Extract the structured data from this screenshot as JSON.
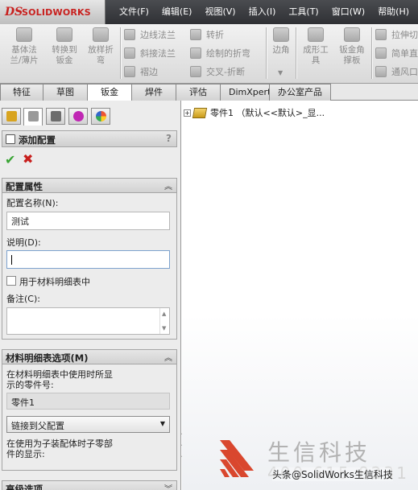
{
  "app": {
    "logo_ds": "DS",
    "logo_name": "SOLIDWORKS"
  },
  "menu": [
    "文件(F)",
    "编辑(E)",
    "视图(V)",
    "插入(I)",
    "工具(T)",
    "窗口(W)",
    "帮助(H)"
  ],
  "ribbon": {
    "large": [
      {
        "line1": "基体法",
        "line2": "兰/薄片"
      },
      {
        "line1": "转换到",
        "line2": "钣金"
      },
      {
        "line1": "放样折",
        "line2": "弯"
      },
      {
        "line1": "边角",
        "line2": ""
      },
      {
        "line1": "成形工",
        "line2": "具"
      },
      {
        "line1": "钣金角",
        "line2": "撑板"
      }
    ],
    "small": [
      "边线法兰",
      "斜接法兰",
      "褶边",
      "转折",
      "绘制的折弯",
      "交叉-折断",
      "拉伸切",
      "简单直",
      "通风口"
    ]
  },
  "tabs": [
    "特征",
    "草图",
    "钣金",
    "焊件",
    "评估",
    "DimXpert",
    "办公室产品"
  ],
  "property_manager": {
    "title": "添加配置",
    "help": "?",
    "ok": "✔",
    "cancel": "✖",
    "config_group": {
      "title": "配置属性",
      "name_label": "配置名称(N):",
      "name_value": "测试",
      "desc_label": "说明(D):",
      "desc_value": "",
      "bom_checkbox_label": "用于材料明细表中",
      "comment_label": "备注(C):"
    },
    "bom_group": {
      "title": "材料明细表选项(M)",
      "text_line1": "在材料明细表中使用时所显",
      "text_line2": "示的零件号:",
      "part_number": "零件1",
      "select_value": "链接到父配置",
      "note_line1": "在使用为子装配体时子零部",
      "note_line2": "件的显示:"
    },
    "advanced_group": {
      "title": "高级选项"
    }
  },
  "feature_tree": {
    "expander": "+",
    "item": "零件1 （默认<<默认>_显..."
  },
  "watermark": {
    "name": "生信科技",
    "phone": "400 615 8231",
    "credit": "头条@SolidWorks生信科技"
  },
  "colors": {
    "brand_red": "#c8201e",
    "ok_green": "#3aa535"
  }
}
